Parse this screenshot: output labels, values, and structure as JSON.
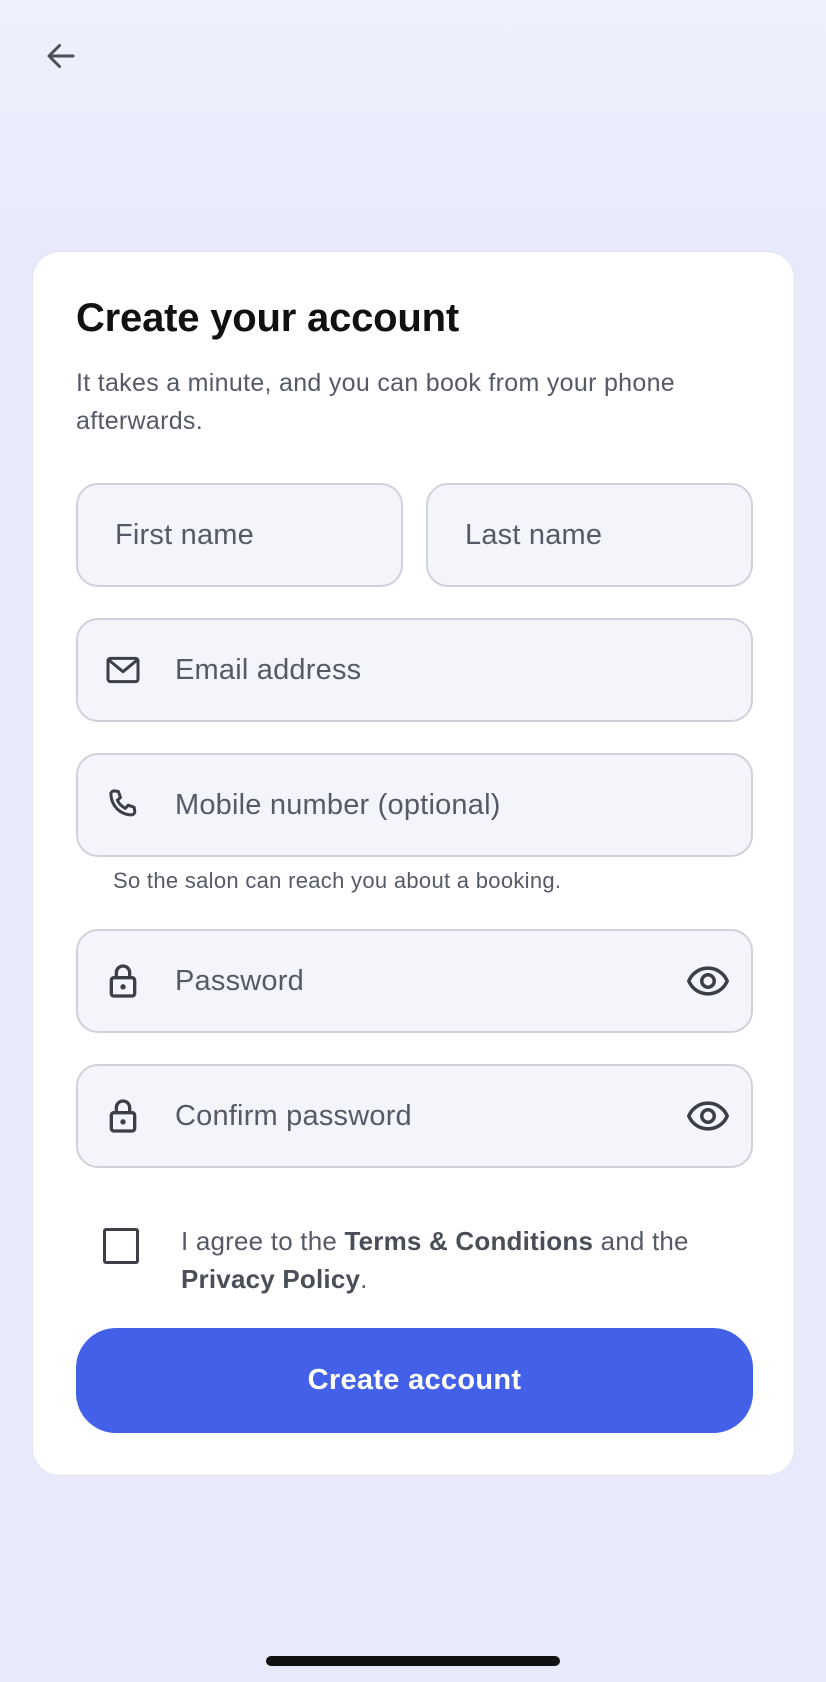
{
  "header": {
    "back_icon": "arrow-left-icon"
  },
  "card": {
    "title": "Create your account",
    "subtitle": "It takes a minute, and you can book from your phone afterwards."
  },
  "form": {
    "first_name": {
      "placeholder": "First name"
    },
    "last_name": {
      "placeholder": "Last name"
    },
    "email": {
      "placeholder": "Email address",
      "icon": "mail-icon"
    },
    "mobile": {
      "placeholder": "Mobile number (optional)",
      "icon": "phone-icon",
      "helper": "So the salon can reach you about a booking."
    },
    "password": {
      "placeholder": "Password",
      "icon": "lock-icon",
      "toggle_icon": "eye-icon"
    },
    "confirm_password": {
      "placeholder": "Confirm password",
      "icon": "lock-icon",
      "toggle_icon": "eye-icon"
    },
    "agree": {
      "checked": false,
      "prefix": "I agree to the ",
      "terms": "Terms & Conditions",
      "middle": " and the ",
      "privacy": "Privacy Policy",
      "suffix": "."
    },
    "submit_label": "Create account"
  },
  "colors": {
    "background": "#e8eafb",
    "accent": "#4361e8",
    "field_bg": "#f4f5fa",
    "field_border": "#cfd2da"
  }
}
